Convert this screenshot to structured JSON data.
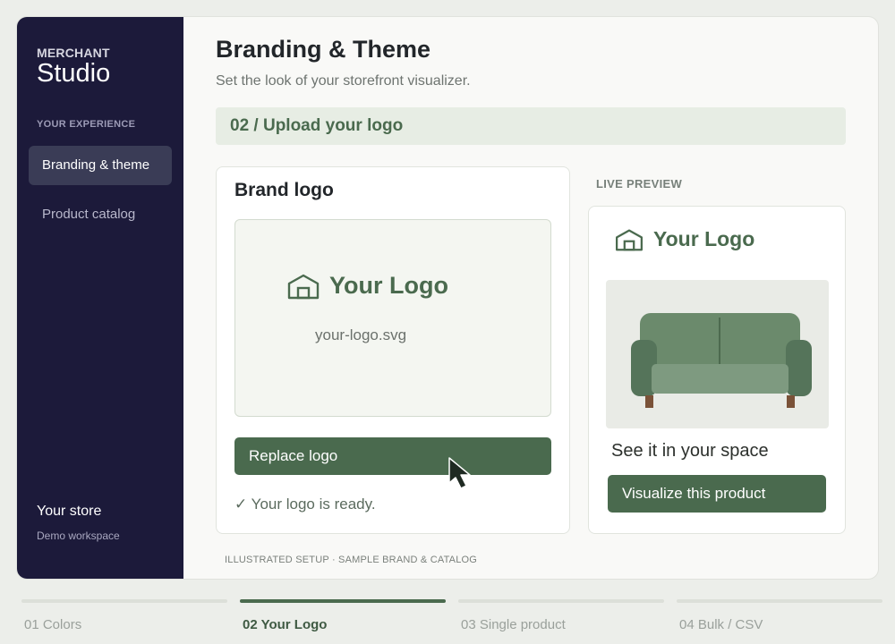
{
  "sidebar": {
    "brand_small": "MERCHANT",
    "brand_big": "Studio",
    "section_label": "YOUR EXPERIENCE",
    "items": [
      {
        "label": "Branding & theme",
        "active": true
      },
      {
        "label": "Product catalog",
        "active": false
      }
    ],
    "store_name": "Your store",
    "store_sub": "Demo workspace"
  },
  "header": {
    "title": "Branding & Theme",
    "subtitle": "Set the look of your storefront visualizer."
  },
  "step_banner": "02 / Upload your logo",
  "brand_logo_card": {
    "title": "Brand logo",
    "logo_text": "Your Logo",
    "file_name": "your-logo.svg",
    "replace_label": "Replace logo",
    "status": "✓ Your logo is ready."
  },
  "live_preview": {
    "label": "LIVE PREVIEW",
    "logo_text": "Your Logo",
    "caption": "See it in your space",
    "button_label": "Visualize this product"
  },
  "footnote": "ILLUSTRATED SETUP · SAMPLE BRAND & CATALOG",
  "steps": [
    {
      "label": "01 Colors",
      "active": false
    },
    {
      "label": "02 Your Logo",
      "active": true
    },
    {
      "label": "03 Single product",
      "active": false
    },
    {
      "label": "04 Bulk / CSV",
      "active": false
    }
  ],
  "colors": {
    "sidebar_bg": "#1c1a3a",
    "accent_green": "#4a6a4e",
    "banner_bg": "#e7ede4"
  },
  "icons": {
    "logo_mark": "house-icon",
    "cursor": "mouse-pointer-icon"
  }
}
